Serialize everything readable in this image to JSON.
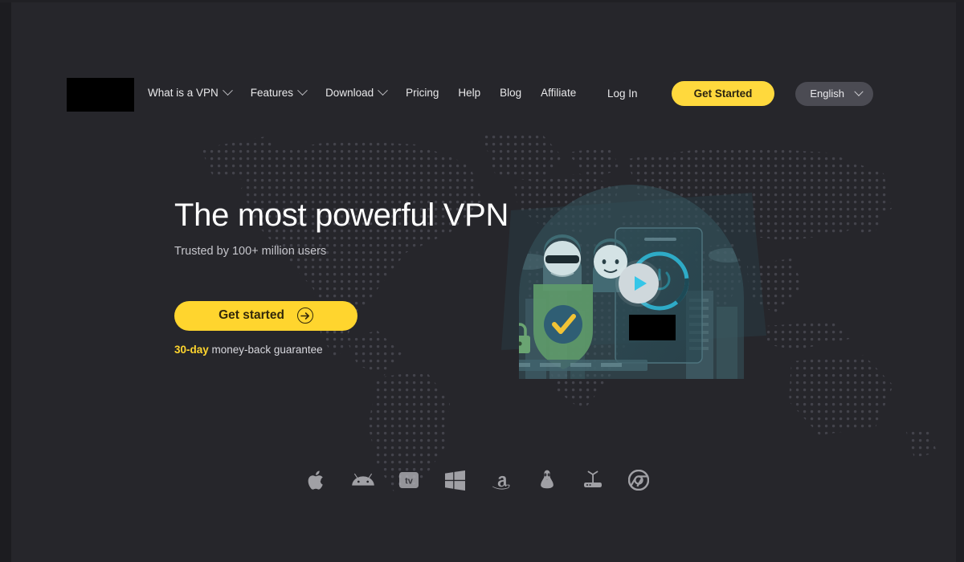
{
  "page": {
    "background_color": "#26262b",
    "accent_yellow": "#FFD52E",
    "accent_cyan": "#35c6e8"
  },
  "header": {
    "logo": {
      "name": "site-logo",
      "redacted": true
    },
    "nav_items": [
      {
        "label": "What is a VPN",
        "has_dropdown": true
      },
      {
        "label": "Features",
        "has_dropdown": true
      },
      {
        "label": "Download",
        "has_dropdown": true
      },
      {
        "label": "Pricing",
        "has_dropdown": false
      },
      {
        "label": "Help",
        "has_dropdown": false
      },
      {
        "label": "Blog",
        "has_dropdown": false
      },
      {
        "label": "Affiliate",
        "has_dropdown": false
      }
    ],
    "login_label": "Log In",
    "get_started_label": "Get Started",
    "language": "English"
  },
  "hero": {
    "title": "The most powerful VPN",
    "subtitle": "Trusted by 100+ million users",
    "cta_label": "Get started",
    "cta_icon": "arrow-right-circle-icon",
    "guarantee_highlight": "30-day",
    "guarantee_rest": " money-back guarantee"
  },
  "illustration": {
    "play_button_label": "play-video",
    "redacted_badge": true
  },
  "platforms": [
    {
      "name": "apple-icon",
      "label": "Apple"
    },
    {
      "name": "android-icon",
      "label": "Android"
    },
    {
      "name": "apple-tv-icon",
      "label": "Apple TV"
    },
    {
      "name": "windows-icon",
      "label": "Windows"
    },
    {
      "name": "amazon-icon",
      "label": "Amazon Fire"
    },
    {
      "name": "linux-icon",
      "label": "Linux"
    },
    {
      "name": "router-icon",
      "label": "Router"
    },
    {
      "name": "chrome-icon",
      "label": "Chrome"
    }
  ]
}
